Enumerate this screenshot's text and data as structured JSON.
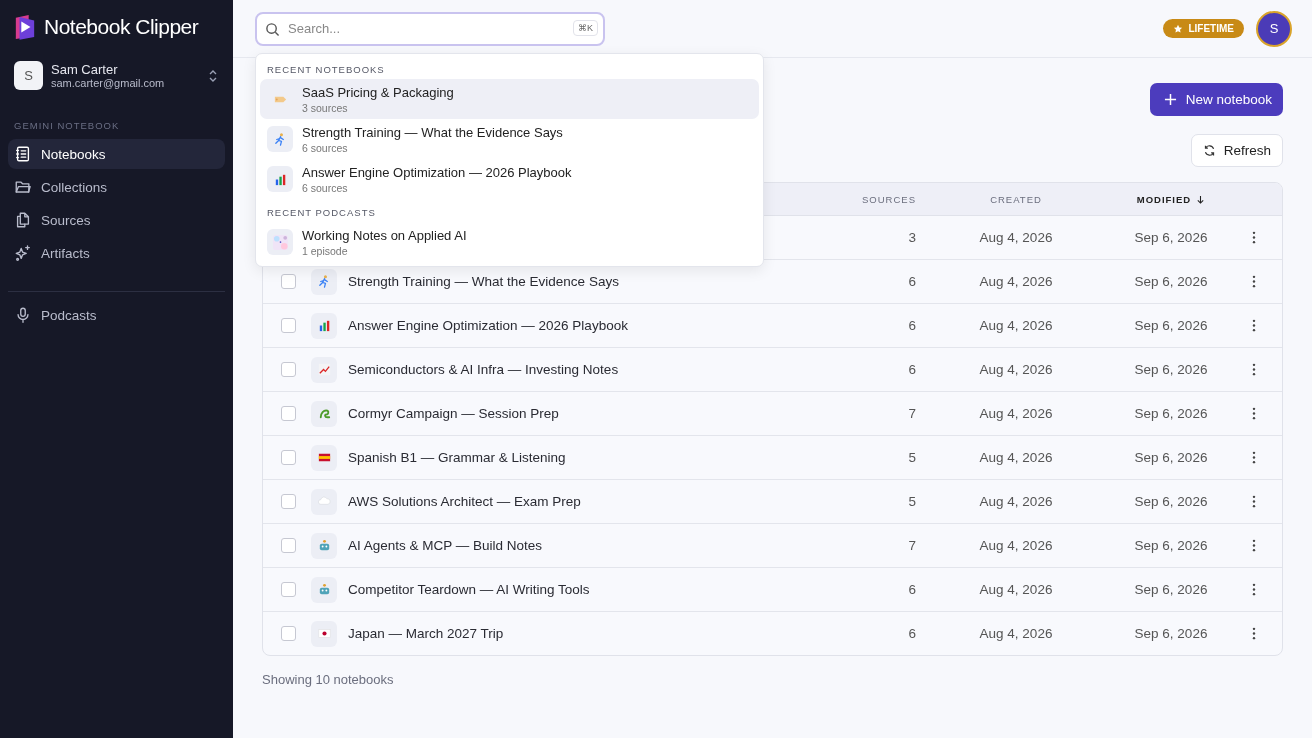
{
  "app": {
    "name": "Notebook Clipper"
  },
  "account": {
    "name": "Sam Carter",
    "email": "sam.carter@gmail.com",
    "initial": "S"
  },
  "sidebar": {
    "section": "GEMINI NOTEBOOK",
    "items": [
      {
        "label": "Notebooks",
        "kind": "notebook",
        "selected": true
      },
      {
        "label": "Collections",
        "kind": "folder",
        "selected": false
      },
      {
        "label": "Sources",
        "kind": "files",
        "selected": false
      },
      {
        "label": "Artifacts",
        "kind": "sparkles",
        "selected": false
      }
    ],
    "extra_items": [
      {
        "label": "Podcasts",
        "kind": "mic",
        "selected": false
      }
    ]
  },
  "topbar": {
    "search": {
      "placeholder": "Search...",
      "shortcut": "⌘K"
    },
    "plan_badge": "LIFETIME",
    "avatar_initial": "S"
  },
  "search_dropdown": {
    "sections": [
      {
        "title": "RECENT NOTEBOOKS",
        "items": [
          {
            "title": "SaaS Pricing & Packaging",
            "subtitle": "3 sources",
            "kind": "tag",
            "selected": true
          },
          {
            "title": "Strength Training — What the Evidence Says",
            "subtitle": "6 sources",
            "kind": "runner",
            "selected": false
          },
          {
            "title": "Answer Engine Optimization — 2026 Playbook",
            "subtitle": "6 sources",
            "kind": "chart",
            "selected": false
          }
        ]
      },
      {
        "title": "RECENT PODCASTS",
        "items": [
          {
            "title": "Working Notes on Applied AI",
            "subtitle": "1 episode",
            "kind": "cover",
            "selected": false
          }
        ]
      }
    ]
  },
  "actions": {
    "new_button": "New notebook",
    "refresh_button": "Refresh"
  },
  "table": {
    "columns": [
      {
        "label": "SOURCES",
        "sorted": false
      },
      {
        "label": "CREATED",
        "sorted": false
      },
      {
        "label": "MODIFIED",
        "sorted": true
      }
    ],
    "rows": [
      {
        "sources": "3",
        "created": "Aug 4, 2026",
        "modified": "Sep 6, 2026"
      },
      {
        "name": "Strength Training — What the Evidence Says",
        "kind": "runner",
        "checked": false,
        "sources": "6",
        "created": "Aug 4, 2026",
        "modified": "Sep 6, 2026"
      },
      {
        "name": "Answer Engine Optimization — 2026 Playbook",
        "kind": "chart",
        "checked": false,
        "sources": "6",
        "created": "Aug 4, 2026",
        "modified": "Sep 6, 2026"
      },
      {
        "name": "Semiconductors & AI Infra — Investing Notes",
        "kind": "trend",
        "checked": false,
        "sources": "6",
        "created": "Aug 4, 2026",
        "modified": "Sep 6, 2026"
      },
      {
        "name": "Cormyr Campaign — Session Prep",
        "kind": "dragon",
        "checked": false,
        "sources": "7",
        "created": "Aug 4, 2026",
        "modified": "Sep 6, 2026"
      },
      {
        "name": "Spanish B1 — Grammar & Listening",
        "kind": "flag-es",
        "checked": false,
        "sources": "5",
        "created": "Aug 4, 2026",
        "modified": "Sep 6, 2026"
      },
      {
        "name": "AWS Solutions Architect — Exam Prep",
        "kind": "cloud",
        "checked": false,
        "sources": "5",
        "created": "Aug 4, 2026",
        "modified": "Sep 6, 2026"
      },
      {
        "name": "AI Agents & MCP — Build Notes",
        "kind": "robot",
        "checked": false,
        "sources": "7",
        "created": "Aug 4, 2026",
        "modified": "Sep 6, 2026"
      },
      {
        "name": "Competitor Teardown — AI Writing Tools",
        "kind": "robot",
        "checked": false,
        "sources": "6",
        "created": "Aug 4, 2026",
        "modified": "Sep 6, 2026"
      },
      {
        "name": "Japan — March 2027 Trip",
        "kind": "flag-jp",
        "checked": false,
        "sources": "6",
        "created": "Aug 4, 2026",
        "modified": "Sep 6, 2026"
      }
    ],
    "footer": "Showing 10 notebooks"
  }
}
